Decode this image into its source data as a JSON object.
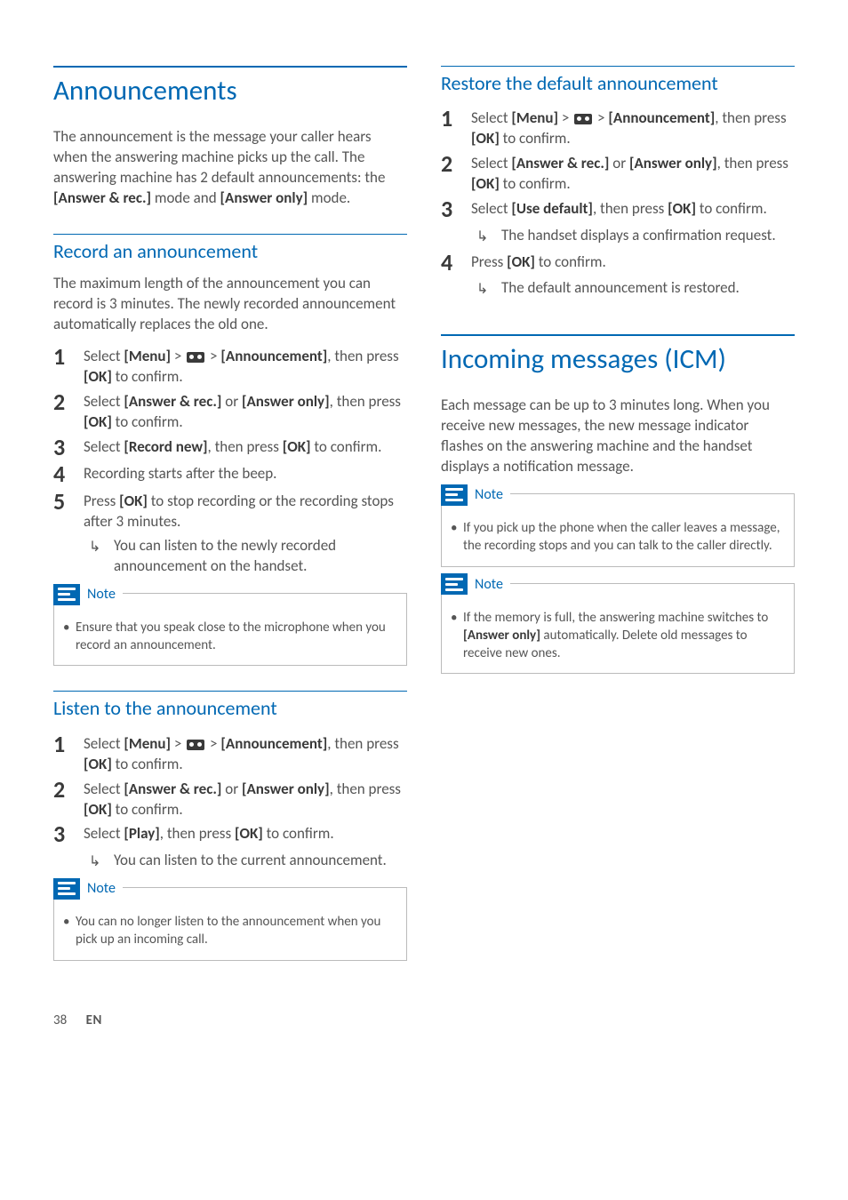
{
  "left": {
    "h1": "Announcements",
    "intro_parts": [
      "The announcement is the message your caller hears when the answering machine picks up the call. The answering machine has 2 default announcements: the ",
      "[Answer & rec.]",
      " mode and ",
      "[Answer only]",
      " mode."
    ],
    "record": {
      "heading": "Record an announcement",
      "intro": "The maximum length of the announcement you can record is 3 minutes. The newly recorded announcement automatically replaces the old one.",
      "steps": [
        {
          "n": "1",
          "parts": [
            "Select ",
            "[Menu]",
            " > ",
            "__ICON__",
            " > ",
            "[Announcement]",
            ", then press ",
            "[OK]",
            " to confirm."
          ]
        },
        {
          "n": "2",
          "parts": [
            "Select ",
            "[Answer & rec.]",
            " or ",
            "[Answer only]",
            ", then press ",
            "[OK]",
            " to confirm."
          ]
        },
        {
          "n": "3",
          "parts": [
            "Select ",
            "[Record new]",
            ", then press ",
            "[OK]",
            " to confirm."
          ]
        },
        {
          "n": "4",
          "parts": [
            "Recording starts after the beep."
          ]
        },
        {
          "n": "5",
          "parts": [
            "Press ",
            "[OK]",
            " to stop recording or the recording stops after 3 minutes."
          ],
          "result": "You can listen to the newly recorded announcement on the handset."
        }
      ],
      "note_label": "Note",
      "note": "Ensure that you speak close to the microphone when you record an announcement."
    },
    "listen": {
      "heading": "Listen to the announcement",
      "steps": [
        {
          "n": "1",
          "parts": [
            "Select ",
            "[Menu]",
            " > ",
            "__ICON__",
            " > ",
            "[Announcement]",
            ", then press ",
            "[OK]",
            " to confirm."
          ]
        },
        {
          "n": "2",
          "parts": [
            "Select ",
            "[Answer & rec.]",
            " or ",
            "[Answer only]",
            ", then press ",
            "[OK]",
            " to confirm."
          ]
        },
        {
          "n": "3",
          "parts": [
            "Select ",
            "[Play]",
            ", then press ",
            "[OK]",
            " to confirm."
          ],
          "result": "You can listen to the current announcement."
        }
      ],
      "note_label": "Note",
      "note": "You can no longer listen to the announcement when you pick up an incoming call."
    }
  },
  "right": {
    "restore": {
      "heading": "Restore the default announcement",
      "steps": [
        {
          "n": "1",
          "parts": [
            "Select ",
            "[Menu]",
            " > ",
            "__ICON__",
            " > ",
            "[Announcement]",
            ", then press ",
            "[OK]",
            " to confirm."
          ]
        },
        {
          "n": "2",
          "parts": [
            "Select ",
            "[Answer & rec.]",
            " or ",
            "[Answer only]",
            ", then press ",
            "[OK]",
            " to confirm."
          ]
        },
        {
          "n": "3",
          "parts": [
            "Select ",
            "[Use default]",
            ", then press ",
            "[OK]",
            " to confirm."
          ],
          "result": "The handset displays a confirmation request."
        },
        {
          "n": "4",
          "parts": [
            "Press ",
            "[OK]",
            " to confirm."
          ],
          "result": "The default announcement is restored."
        }
      ]
    },
    "icm": {
      "heading": "Incoming messages (ICM)",
      "intro": "Each message can be up to 3 minutes long. When you receive new messages, the new message indicator flashes on the answering machine and the handset displays a notification message.",
      "note1_label": "Note",
      "note1": "If you pick up the phone when the caller leaves a message, the recording stops and you can talk to the caller directly.",
      "note2_label": "Note",
      "note2_parts": [
        "If the memory is full, the answering machine switches to ",
        "[Answer only]",
        " automatically. Delete old messages to receive new ones."
      ]
    }
  },
  "footer": {
    "page": "38",
    "lang": "EN"
  }
}
